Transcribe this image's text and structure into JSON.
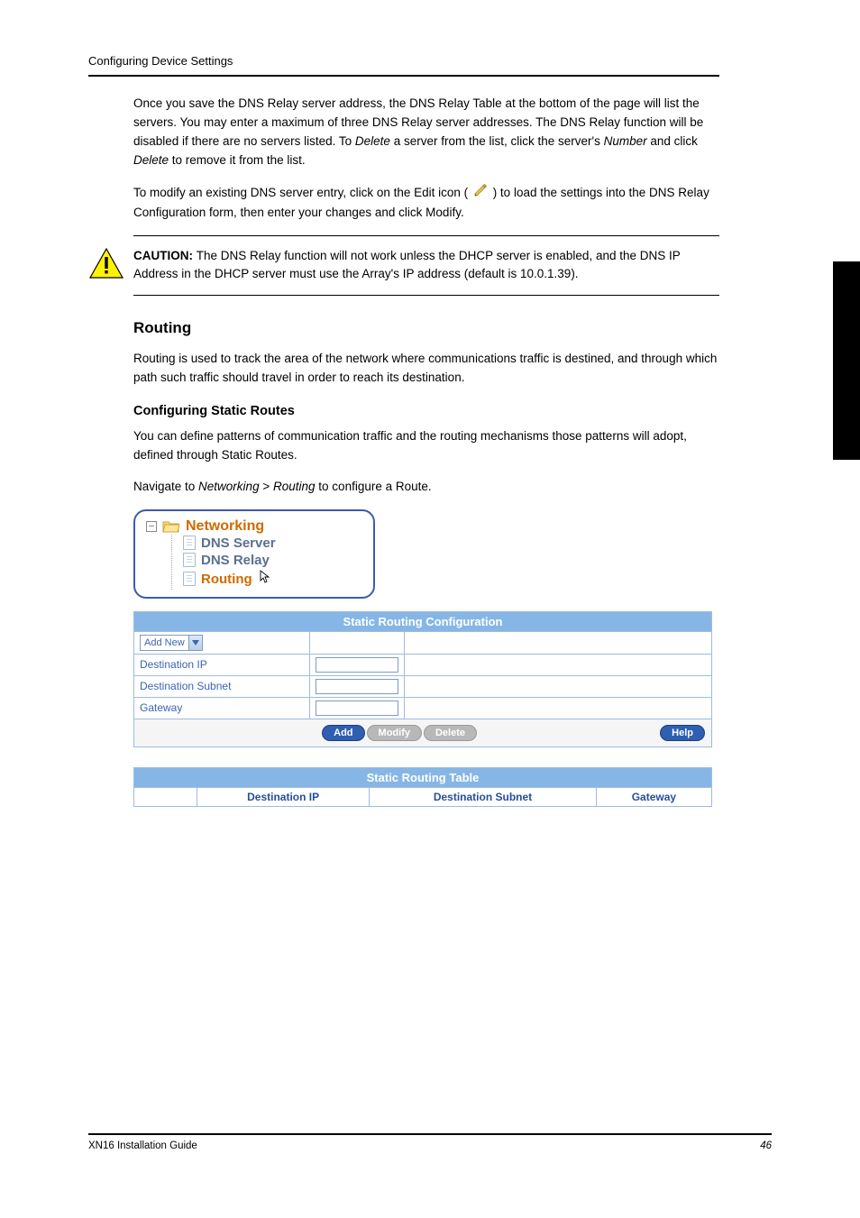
{
  "header": {
    "title": "Configuring Device Settings"
  },
  "body": {
    "intro_1": "Once you save the DNS Relay server address, the DNS Relay Table at the bottom of the page will list the servers. You may enter a maximum of three DNS Relay server addresses. The DNS Relay function will be disabled if there are no servers listed. To ",
    "intro_italic_1": "Delete",
    "intro_2": " a server from the list, click the server's ",
    "intro_italic_2": "Number",
    "intro_3": " and click ",
    "intro_italic_3": "Delete",
    "intro_4": " to remove it from the list.",
    "modify_1": "To modify an existing DNS server entry, click on the Edit icon (",
    "modify_2": ") to load the settings into the DNS Relay Configuration form, then enter your changes and click Modify.",
    "caution_label": "CAUTION: ",
    "caution_text": "The DNS Relay function will not work unless the DHCP server is enabled, and the DNS IP Address in the DHCP server must use the Array's IP address (default is 10.0.1.39)."
  },
  "sections": {
    "routing": {
      "title": "Routing",
      "desc": "Routing is used to track the area of the network where communications traffic is destined, and through which path such traffic should travel in order to reach its destination.",
      "config_title": "Configuring Static Routes",
      "config_desc": "You can define patterns of communication traffic and the routing mechanisms those patterns will adopt, defined through Static Routes.",
      "nav_1": "Navigate to ",
      "nav_item_1": "Networking",
      "nav_sep": " > ",
      "nav_item_2": "Routing",
      "nav_3": " to configure a Route."
    }
  },
  "tree": {
    "root": "Networking",
    "items": [
      "DNS Server",
      "DNS Relay",
      "Routing"
    ]
  },
  "config_table": {
    "title": "Static Routing Configuration",
    "select_value": "Add New",
    "rows": [
      {
        "label": "Destination IP"
      },
      {
        "label": "Destination Subnet"
      },
      {
        "label": "Gateway"
      }
    ],
    "buttons": {
      "add": "Add",
      "modify": "Modify",
      "delete": "Delete",
      "help": "Help"
    }
  },
  "routing_table": {
    "title": "Static Routing Table",
    "columns": [
      "Destination IP",
      "Destination Subnet",
      "Gateway"
    ]
  },
  "footer": {
    "left": "XN16 Installation Guide",
    "right": "46"
  }
}
